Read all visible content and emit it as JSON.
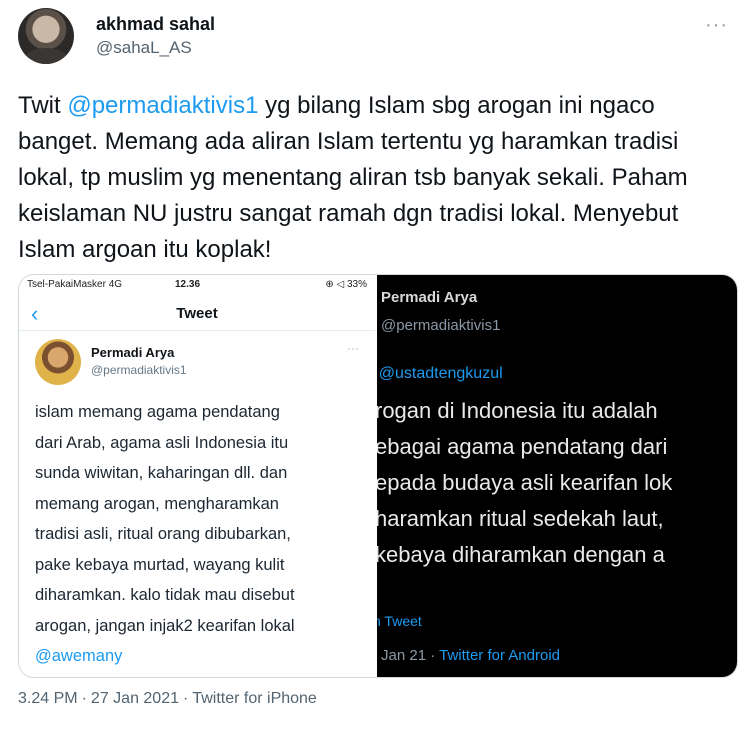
{
  "author": {
    "name": "akhmad sahal",
    "handle": "@sahaL_AS",
    "more_icon": "more-horizontal-icon"
  },
  "tweet": {
    "prefix": "Twit ",
    "mention": "@permadiaktivis1",
    "text": " yg bilang Islam sbg arogan ini ngaco banget. Memang ada aliran Islam tertentu yg haramkan tradisi lokal, tp muslim yg menentang aliran tsb banyak sekali. Paham keislaman NU justru sangat ramah dgn tradisi lokal. Menyebut Islam argoan itu koplak!"
  },
  "screenshot_left": {
    "status": {
      "carrier": "Tsel-PakaiMasker  4G",
      "time": "12.36",
      "battery": "⊕ ◁ 33%"
    },
    "nav": {
      "back": "‹",
      "title": "Tweet"
    },
    "user": {
      "name": "Permadi Arya",
      "handle": "@permadiaktivis1",
      "more": "···"
    },
    "lines": [
      "islam memang agama pendatang",
      "dari Arab, agama asli Indonesia itu",
      "sunda wiwitan, kaharingan dll. dan",
      "memang arogan, mengharamkan",
      "tradisi asli, ritual orang dibubarkan,",
      "pake kebaya murtad, wayang kulit",
      "diharamkan. kalo tidak mau disebut",
      "arogan, jangan injak2 kearifan lokal"
    ],
    "mention": "@awemany"
  },
  "screenshot_right": {
    "name": "Permadi Arya",
    "handle": "@permadiaktivis1",
    "reply_to": "· @ustadtengkuzul",
    "lines": [
      "rogan di Indonesia itu adalah",
      "ebagai agama pendatang dari",
      "epada budaya asli kearifan lok",
      "haramkan ritual sedekah laut,",
      "kebaya diharamkan dengan a"
    ],
    "tweet_label": "n Tweet",
    "date": "Jan 21 · ",
    "source": "Twitter for Android"
  },
  "footer": {
    "time": "3.24 PM",
    "date": "27 Jan 2021",
    "source": "Twitter for iPhone"
  }
}
